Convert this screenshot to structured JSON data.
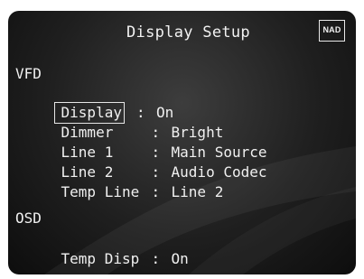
{
  "header": {
    "title": "Display Setup",
    "logo_text": "NAD"
  },
  "vfd": {
    "heading": "VFD",
    "rows": [
      {
        "label": "Display",
        "value": "On",
        "selected": true
      },
      {
        "label": "Dimmer",
        "value": "Bright"
      },
      {
        "label": "Line 1",
        "value": "Main Source"
      },
      {
        "label": "Line 2",
        "value": "Audio Codec"
      },
      {
        "label": "Temp Line",
        "value": "Line 2"
      }
    ]
  },
  "osd": {
    "heading": "OSD",
    "rows": [
      {
        "label": "Temp Disp",
        "value": "On"
      }
    ]
  },
  "separator": ":",
  "colors": {
    "text": "#f0f0f0",
    "background": "#1f1f1f"
  }
}
